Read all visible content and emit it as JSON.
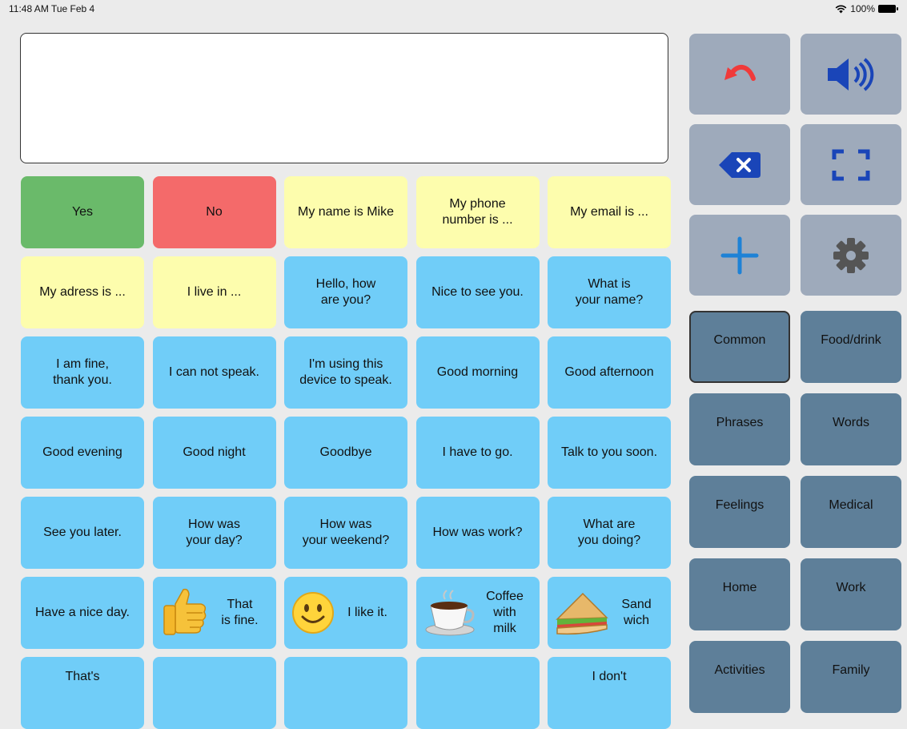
{
  "status": {
    "time": "11:48 AM  Tue Feb 4",
    "battery": "100%"
  },
  "message": "",
  "colors": {
    "yes": "#6aba6a",
    "no": "#f46a6a",
    "personal": "#fdfdad",
    "phrase": "#70cdf8",
    "control": "#9eaabb",
    "category": "#5e7f99",
    "accent_red": "#f03a3a",
    "accent_blue": "#1a45b8"
  },
  "tiles": [
    {
      "label": "Yes",
      "color": "yes"
    },
    {
      "label": "No",
      "color": "no"
    },
    {
      "label": "My name is Mike",
      "color": "personal"
    },
    {
      "label": "My phone\nnumber is ...",
      "color": "personal"
    },
    {
      "label": "My email is ...",
      "color": "personal"
    },
    {
      "label": "My adress is ...",
      "color": "personal"
    },
    {
      "label": "I live in ...",
      "color": "personal"
    },
    {
      "label": "Hello, how\nare you?",
      "color": "phrase"
    },
    {
      "label": "Nice to see you.",
      "color": "phrase"
    },
    {
      "label": "What is\nyour name?",
      "color": "phrase"
    },
    {
      "label": "I am fine,\nthank you.",
      "color": "phrase"
    },
    {
      "label": "I can not speak.",
      "color": "phrase"
    },
    {
      "label": "I'm using this\ndevice to speak.",
      "color": "phrase"
    },
    {
      "label": "Good morning",
      "color": "phrase"
    },
    {
      "label": "Good afternoon",
      "color": "phrase"
    },
    {
      "label": "Good evening",
      "color": "phrase"
    },
    {
      "label": "Good night",
      "color": "phrase"
    },
    {
      "label": "Goodbye",
      "color": "phrase"
    },
    {
      "label": "I have to go.",
      "color": "phrase"
    },
    {
      "label": "Talk to you soon.",
      "color": "phrase"
    },
    {
      "label": "See you later.",
      "color": "phrase"
    },
    {
      "label": "How was\nyour day?",
      "color": "phrase"
    },
    {
      "label": "How was\nyour weekend?",
      "color": "phrase"
    },
    {
      "label": "How was work?",
      "color": "phrase"
    },
    {
      "label": "What are\nyou doing?",
      "color": "phrase"
    },
    {
      "label": "Have a nice day.",
      "color": "phrase"
    },
    {
      "label": "That\nis fine.",
      "color": "phrase",
      "icon": "thumbs-up-icon"
    },
    {
      "label": "I like it.",
      "color": "phrase",
      "icon": "smiley-icon"
    },
    {
      "label": "Coffee\nwith\nmilk",
      "color": "phrase",
      "icon": "coffee-cup-icon"
    },
    {
      "label": "Sand\nwich",
      "color": "phrase",
      "icon": "sandwich-icon"
    },
    {
      "label": "That's",
      "color": "phrase"
    },
    {
      "label": "",
      "color": "phrase"
    },
    {
      "label": "",
      "color": "phrase"
    },
    {
      "label": "",
      "color": "phrase"
    },
    {
      "label": "I don't",
      "color": "phrase"
    }
  ],
  "controls": [
    {
      "name": "undo-button",
      "icon": "undo-icon"
    },
    {
      "name": "speak-button",
      "icon": "speaker-icon"
    },
    {
      "name": "delete-button",
      "icon": "backspace-icon"
    },
    {
      "name": "fullscreen-button",
      "icon": "fullscreen-icon"
    },
    {
      "name": "add-button",
      "icon": "plus-icon"
    },
    {
      "name": "settings-button",
      "icon": "gear-icon"
    }
  ],
  "categories": [
    {
      "label": "Common",
      "active": true
    },
    {
      "label": "Food/drink"
    },
    {
      "label": "Phrases"
    },
    {
      "label": "Words"
    },
    {
      "label": "Feelings"
    },
    {
      "label": "Medical"
    },
    {
      "label": "Home"
    },
    {
      "label": "Work"
    },
    {
      "label": "Activities"
    },
    {
      "label": "Family"
    }
  ]
}
